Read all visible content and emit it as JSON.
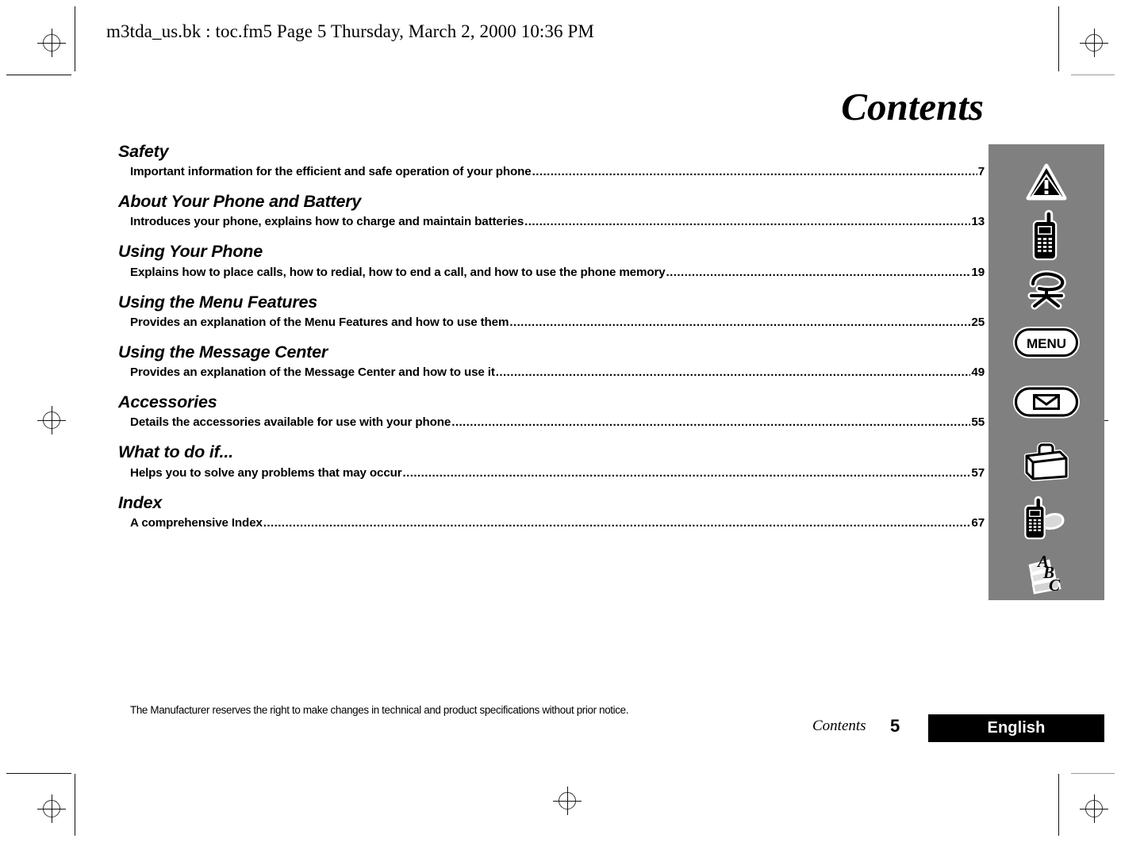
{
  "header": {
    "slug": "m3tda_us.bk : toc.fm5  Page 5  Thursday, March 2, 2000  10:36 PM"
  },
  "page": {
    "title": "Contents"
  },
  "toc": {
    "entries": [
      {
        "title": "Safety",
        "description": "Important information for the efficient and safe operation of your phone",
        "page": "7",
        "icon": "warning-triangle-icon"
      },
      {
        "title": "About Your Phone and Battery",
        "description": "Introduces your phone, explains how to charge and maintain batteries",
        "page": "13",
        "icon": "mobile-phone-icon"
      },
      {
        "title": "Using Your Phone",
        "description": "Explains how to place calls, how to redial, how to end a call, and how to use the phone memory",
        "page": "19",
        "icon": "handset-call-icon"
      },
      {
        "title": "Using the Menu Features",
        "description": "Provides an explanation of the Menu Features and how to use them",
        "page": "25",
        "icon": "menu-button-icon"
      },
      {
        "title": "Using the Message Center",
        "description": "Provides an explanation of the Message Center and how to use it",
        "page": "49",
        "icon": "envelope-message-icon"
      },
      {
        "title": "Accessories",
        "description": "Details the accessories available for use with your phone",
        "page": "55",
        "icon": "briefcase-icon"
      },
      {
        "title": "What to do if...",
        "description": "Helps you to solve any problems that may occur",
        "page": "57",
        "icon": "phone-troubleshoot-icon"
      },
      {
        "title": "Index",
        "description": "A comprehensive Index",
        "page": "67",
        "icon": "abc-index-icon"
      }
    ],
    "leader_char": "."
  },
  "sidebar": {
    "menu_button_label": "MENU",
    "background_color": "#808080",
    "icons": [
      "warning-triangle-icon",
      "mobile-phone-icon",
      "handset-call-icon",
      "menu-button-icon",
      "envelope-message-icon",
      "briefcase-icon",
      "phone-troubleshoot-icon",
      "abc-index-icon"
    ]
  },
  "footer": {
    "disclaimer": "The Manufacturer reserves the right to make changes in technical and product specifications without prior notice.",
    "section": "Contents",
    "page_number": "5",
    "language": "English",
    "language_bar_color": "#000000"
  }
}
